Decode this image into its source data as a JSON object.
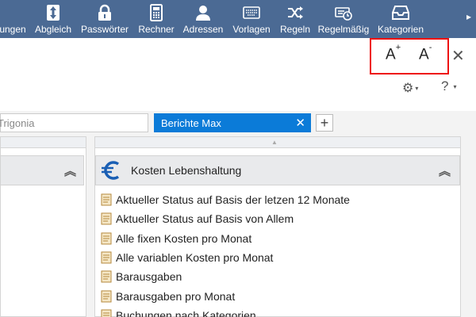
{
  "toolbar": {
    "items": [
      {
        "label": "ungen",
        "icon": "partial-icon"
      },
      {
        "label": "Abgleich",
        "icon": "sync-arrows-icon"
      },
      {
        "label": "Passwörter",
        "icon": "lock-icon"
      },
      {
        "label": "Rechner",
        "icon": "calculator-icon"
      },
      {
        "label": "Adressen",
        "icon": "person-icon"
      },
      {
        "label": "Vorlagen",
        "icon": "keyboard-icon"
      },
      {
        "label": "Regeln",
        "icon": "shuffle-icon"
      },
      {
        "label": "Regelmäßig",
        "icon": "recurring-icon"
      },
      {
        "label": "Kategorien",
        "icon": "inbox-tray-icon"
      }
    ],
    "more": "▸"
  },
  "font_controls": {
    "increase_base": "A",
    "increase_sup": "+",
    "decrease_base": "A",
    "decrease_sup": "-"
  },
  "close_label": "✕",
  "settings": {
    "gear": "⚙",
    "help": "?",
    "caret": "▾"
  },
  "tabs": [
    {
      "label": "Trigonia",
      "active": false
    },
    {
      "label": "Berichte Max",
      "active": true,
      "close": "✕"
    }
  ],
  "tab_add": "+",
  "left_panel": {
    "collapse": "︽"
  },
  "right_panel": {
    "title": "Kosten Lebenshaltung",
    "collapse": "︽",
    "items": [
      "Aktueller Status auf Basis der letzen 12 Monate",
      "Aktueller Status auf Basis von Allem",
      "Alle fixen Kosten pro Monat",
      "Alle variablen Kosten pro Monat",
      "Barausgaben",
      "Barausgaben pro Monat",
      "Buchungen nach Kategorien"
    ]
  },
  "colors": {
    "toolbar": "#4b6a94",
    "active_tab": "#0b7bd8",
    "highlight": "#e11111"
  }
}
